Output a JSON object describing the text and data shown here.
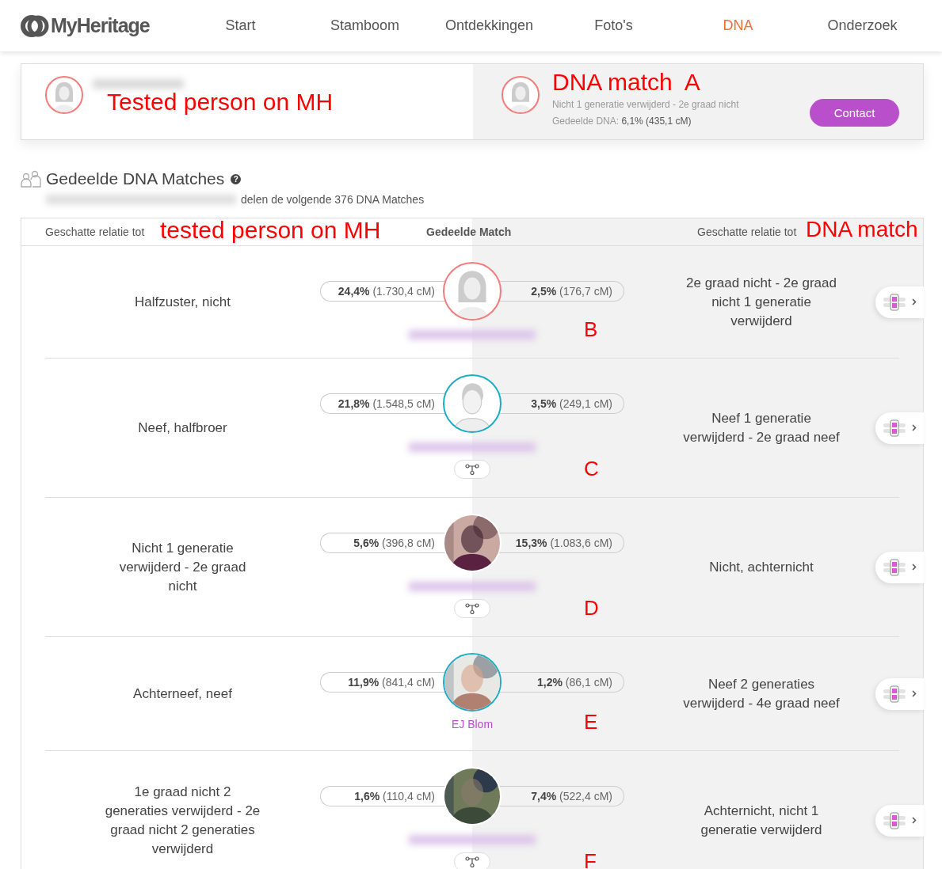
{
  "nav": {
    "logo": "MyHeritage",
    "items": [
      {
        "label": "Start",
        "selected": false
      },
      {
        "label": "Stamboom",
        "selected": false
      },
      {
        "label": "Ontdekkingen",
        "selected": false
      },
      {
        "label": "Foto's",
        "selected": false
      },
      {
        "label": "DNA",
        "selected": true
      },
      {
        "label": "Onderzoek",
        "selected": false
      }
    ]
  },
  "comparison": {
    "tested_person": {
      "annotation": "Tested person on MH",
      "avatar": {
        "kind": "female",
        "color": "#f47c7c"
      }
    },
    "match": {
      "annotation": "DNA match  A",
      "avatar": {
        "kind": "female",
        "color": "#f47c7c"
      },
      "relation": "Nicht 1 generatie verwijderd - 2e graad nicht",
      "shared_label": "Gedeelde DNA:",
      "shared_value": "6,1% (435,1 cM)"
    },
    "contact_button": "Contact"
  },
  "section": {
    "title": "Gedeelde DNA Matches",
    "help": "?",
    "subtitle": "delen de volgende 376 DNA Matches"
  },
  "table": {
    "header": {
      "left": "Geschatte relatie tot",
      "left_annotation": "tested person on MH",
      "center": "Gedeelde Match",
      "right": "Geschatte relatie tot",
      "right_annotation": "DNA match"
    },
    "rows": [
      {
        "left_relation": "Halfzuster, nicht",
        "left_pct": "24,4%",
        "left_cm": "(1.730,4 cM)",
        "avatar": {
          "kind": "female",
          "color": "#f47c7c"
        },
        "right_pct": "2,5%",
        "right_cm": "(176,7 cM)",
        "right_relation": "2e graad nicht - 2e graad nicht 1 generatie verwijderd",
        "annotation": "B",
        "tree_button": false
      },
      {
        "left_relation": "Neef, halfbroer",
        "left_pct": "21,8%",
        "left_cm": "(1.548,5 cM)",
        "avatar": {
          "kind": "male",
          "color": "#1aaec6"
        },
        "right_pct": "3,5%",
        "right_cm": "(249,1 cM)",
        "right_relation": "Neef 1 generatie verwijderd - 2e graad neef",
        "annotation": "C",
        "tree_button": true
      },
      {
        "left_relation": "Nicht 1 generatie verwijderd - 2e graad nicht",
        "left_pct": "5,6%",
        "left_cm": "(396,8 cM)",
        "right_pct": "15,3%",
        "right_cm": "(1.083,6 cM)",
        "right_relation": "Nicht, achternicht",
        "annotation": "D",
        "tree_button": true
      },
      {
        "left_relation": "Achterneef, neef",
        "left_pct": "11,9%",
        "left_cm": "(841,4 cM)",
        "name": "EJ Blom",
        "right_pct": "1,2%",
        "right_cm": "(86,1 cM)",
        "right_relation": "Neef 2 generaties verwijderd - 4e graad neef",
        "annotation": "E",
        "tree_button": false
      },
      {
        "left_relation": "1e graad nicht 2 generaties verwijderd - 2e graad nicht 2 generaties verwijderd",
        "left_pct": "1,6%",
        "left_cm": "(110,4 cM)",
        "right_pct": "7,4%",
        "right_cm": "(522,4 cM)",
        "right_relation": "Achternicht, nicht 1 generatie verwijderd",
        "annotation": "F",
        "tree_button": true
      }
    ]
  }
}
